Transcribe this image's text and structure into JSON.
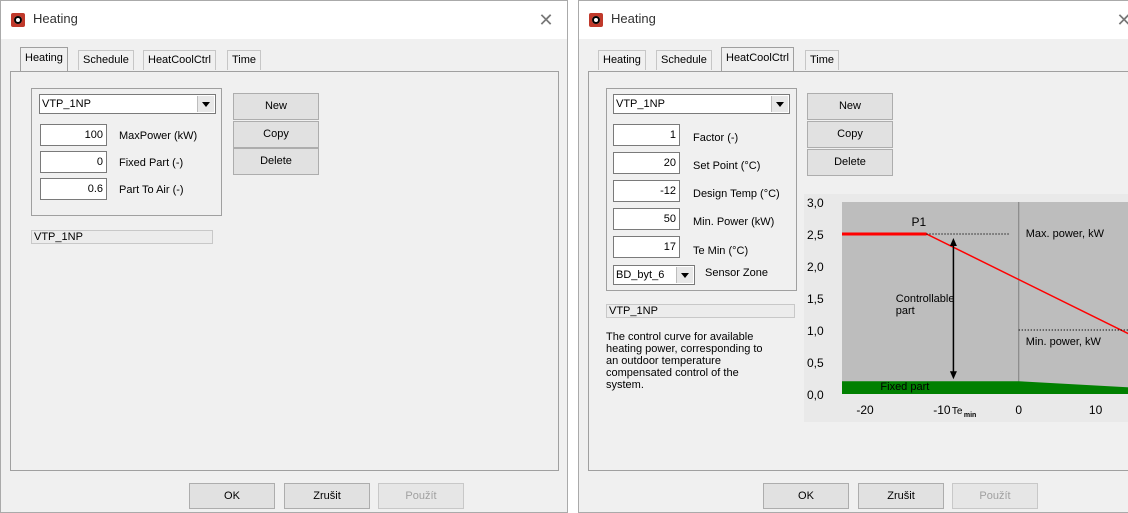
{
  "left_window": {
    "title": "Heating",
    "tabs": [
      {
        "label": "Heating",
        "active": true
      },
      {
        "label": "Schedule",
        "active": false
      },
      {
        "label": "HeatCoolCtrl",
        "active": false
      },
      {
        "label": "Time",
        "active": false
      }
    ],
    "heater_select": "VTP_1NP",
    "fields": [
      {
        "value": "100",
        "label": "MaxPower (kW)"
      },
      {
        "value": "0",
        "label": "Fixed Part (-)"
      },
      {
        "value": "0.6",
        "label": "Part To Air (-)"
      }
    ],
    "buttons": {
      "new": "New",
      "copy": "Copy",
      "delete": "Delete"
    },
    "status_text": "VTP_1NP",
    "dialog_buttons": {
      "ok": "OK",
      "cancel": "Zrušit",
      "apply": "Použít"
    }
  },
  "right_window": {
    "title": "Heating",
    "tabs": [
      {
        "label": "Heating",
        "active": false
      },
      {
        "label": "Schedule",
        "active": false
      },
      {
        "label": "HeatCoolCtrl",
        "active": true
      },
      {
        "label": "Time",
        "active": false
      }
    ],
    "heater_select": "VTP_1NP",
    "fields": [
      {
        "value": "1",
        "label": "Factor (-)"
      },
      {
        "value": "20",
        "label": "Set Point (°C)"
      },
      {
        "value": "-12",
        "label": "Design Temp (°C)"
      },
      {
        "value": "50",
        "label": "Min. Power (kW)"
      },
      {
        "value": "17",
        "label": "Te Min (°C)"
      }
    ],
    "sensor_zone": {
      "value": "BD_byt_6",
      "label": "Sensor Zone"
    },
    "buttons": {
      "new": "New",
      "copy": "Copy",
      "delete": "Delete"
    },
    "status_text": "VTP_1NP",
    "description": [
      "The control curve for available",
      "heating power, corresponding to",
      "an outdoor temperature",
      "compensated control of the",
      "system."
    ],
    "dialog_buttons": {
      "ok": "OK",
      "cancel": "Zrušit",
      "apply": "Použít"
    }
  },
  "chart_data": {
    "type": "line",
    "y_tick_labels": [
      "3,0",
      "2,5",
      "2,0",
      "1,5",
      "1,0",
      "0,5",
      "0,0"
    ],
    "x_tick_labels": [
      "-20",
      "-10",
      "0",
      "10"
    ],
    "x_te_label": "Te",
    "x_te_sub": "min",
    "ylim": [
      0,
      3
    ],
    "xlim": [
      -23,
      15
    ],
    "annotations": {
      "p1": "P1",
      "max_power": "Max. power, kW",
      "min_power": "Min. power, kW",
      "controllable_1": "Controllable",
      "controllable_2": "part",
      "fixed_part": "Fixed part"
    },
    "series": [
      {
        "color": "#ff0000",
        "x": [
          -23,
          -12,
          15
        ],
        "y": [
          2.5,
          2.5,
          0.9
        ]
      },
      {
        "color": "#008000",
        "x": [
          -23,
          0,
          15
        ],
        "y": [
          0.2,
          0.2,
          0.1
        ]
      }
    ],
    "max_power_level": 2.5,
    "min_power_level": 1.0,
    "grid": false
  },
  "colors": {
    "accent_red": "#ff0000",
    "fixed_green": "#008000",
    "chart_bg": "#bdbdbd"
  }
}
